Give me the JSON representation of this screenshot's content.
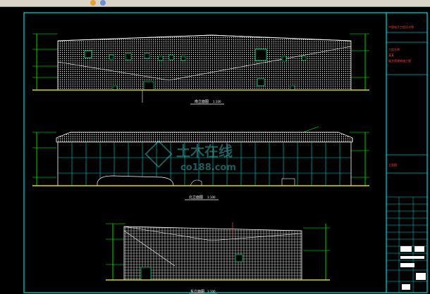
{
  "toolbar": {
    "tabs": [
      "",
      "",
      "",
      ""
    ],
    "icons": [
      "undo-icon",
      "refresh-icon"
    ]
  },
  "drawing": {
    "elevation_titles": [
      "南立面图",
      "北立面图",
      "东立面图"
    ],
    "scale_label": "1:100",
    "title_block": {
      "company": "中国电子工程设计院",
      "project_lines": [
        "工程名称",
        "某某",
        "展览馆建筑施工图"
      ],
      "sheet_label": "立面图"
    },
    "watermark": {
      "text": "土木在线",
      "sub": "co188.com"
    },
    "colors": {
      "background": "#000000",
      "frame": "#00ffff",
      "facade": "#ffffff",
      "dimension": "#00ff00",
      "ground": "#ffff00",
      "text": "#ff4040",
      "glass": "#00cccc"
    }
  }
}
